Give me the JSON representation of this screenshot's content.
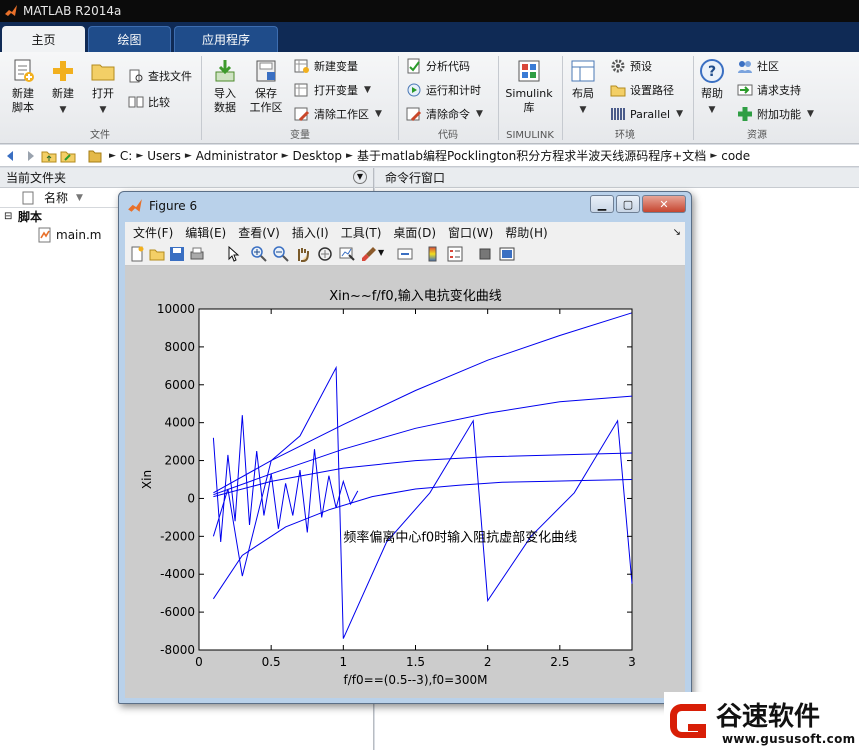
{
  "window": {
    "title": "MATLAB R2014a",
    "accent": "#0f2a55"
  },
  "tabs": [
    {
      "label": "主页",
      "active": true
    },
    {
      "label": "绘图",
      "active": false
    },
    {
      "label": "应用程序",
      "active": false
    }
  ],
  "ribbon": {
    "file": {
      "group_label": "文件",
      "new_script": "新建\n脚本",
      "new": "新建",
      "open": "打开",
      "find_files": "查找文件",
      "compare": "比较"
    },
    "variable": {
      "group_label": "变量",
      "import": "导入\n数据",
      "save_ws": "保存\n工作区",
      "new_var": "新建变量",
      "open_var": "打开变量",
      "clear_ws": "清除工作区"
    },
    "code": {
      "group_label": "代码",
      "analyze": "分析代码",
      "run_time": "运行和计时",
      "clear_cmd": "清除命令"
    },
    "simulink": {
      "group_label": "SIMULINK",
      "label": "Simulink\n库"
    },
    "environment": {
      "group_label": "环境",
      "layout": "布局",
      "prefs": "预设",
      "set_path": "设置路径",
      "parallel": "Parallel"
    },
    "resources": {
      "group_label": "资源",
      "help": "帮助",
      "community": "社区",
      "support": "请求支持",
      "addons": "附加功能"
    }
  },
  "address_bar": {
    "crumbs": [
      "C:",
      "Users",
      "Administrator",
      "Desktop",
      "基于matlab编程Pocklington积分方程求半波天线源码程序+文档",
      "code"
    ]
  },
  "left_panel": {
    "title": "当前文件夹",
    "column": "名称",
    "group": "脚本",
    "files": [
      "main.m"
    ]
  },
  "right_panel": {
    "title": "命令行窗口"
  },
  "figure": {
    "title": "Figure 6",
    "menu": [
      "文件(F)",
      "编辑(E)",
      "查看(V)",
      "插入(I)",
      "工具(T)",
      "桌面(D)",
      "窗口(W)",
      "帮助(H)"
    ],
    "tools": [
      "new-icon",
      "open-icon",
      "save-icon",
      "print-icon",
      "pointer-icon",
      "zoom-in-icon",
      "zoom-out-icon",
      "pan-icon",
      "rotate-icon",
      "data-cursor-icon",
      "brush-icon",
      "link-icon",
      "colorbar-icon",
      "legend-icon",
      "hide-plot-tools-icon",
      "show-plot-tools-icon"
    ]
  },
  "chart_data": {
    "type": "line",
    "title": "Xin~~f/f0,输入电抗变化曲线",
    "xlabel": "f/f0==(0.5--3),f0=300M",
    "ylabel": "Xin",
    "xlim": [
      0,
      3
    ],
    "ylim": [
      -8000,
      10000
    ],
    "xticks": [
      0,
      0.5,
      1,
      1.5,
      2,
      2.5,
      3
    ],
    "yticks": [
      -8000,
      -6000,
      -4000,
      -2000,
      0,
      2000,
      4000,
      6000,
      8000,
      10000
    ],
    "grid": false,
    "annotation": {
      "text": "频率偏离中心f0时输入阻抗虚部变化曲线",
      "x": 1.0,
      "y": -2000
    },
    "line_color": "#0000ee",
    "series": [
      {
        "x": [
          0.1,
          0.5,
          1,
          1.5,
          2,
          2.5,
          3
        ],
        "y": [
          300,
          2000,
          3900,
          5700,
          7300,
          8600,
          9800
        ]
      },
      {
        "x": [
          0.1,
          0.5,
          1,
          1.5,
          2,
          2.5,
          3
        ],
        "y": [
          200,
          1300,
          2600,
          3700,
          4500,
          5100,
          5400
        ]
      },
      {
        "x": [
          0.1,
          0.5,
          1,
          1.5,
          2,
          2.5,
          3
        ],
        "y": [
          100,
          900,
          1600,
          2000,
          2200,
          2300,
          2400
        ]
      },
      {
        "x": [
          0.1,
          0.3,
          0.6,
          0.9,
          1.2,
          1.5,
          1.8,
          2.1,
          2.4,
          2.7,
          3
        ],
        "y": [
          -5300,
          -3000,
          -1500,
          -600,
          100,
          500,
          700,
          850,
          900,
          950,
          1000
        ]
      },
      {
        "x": [
          0.1,
          0.2,
          0.3,
          0.5,
          0.7,
          0.95,
          1.0,
          1.3,
          1.6,
          1.9,
          2.0,
          2.3,
          2.6,
          2.9,
          3.0
        ],
        "y": [
          -2000,
          500,
          -4100,
          2000,
          3300,
          6900,
          -7400,
          -2300,
          300,
          4100,
          -5400,
          -2000,
          300,
          4100,
          -4500
        ]
      },
      {
        "x": [
          0.1,
          0.15,
          0.2,
          0.25,
          0.3,
          0.35,
          0.4,
          0.45,
          0.5,
          0.55,
          0.6,
          0.65,
          0.7,
          0.75,
          0.8,
          0.85,
          0.9,
          0.95,
          1.0,
          1.05,
          1.1
        ],
        "y": [
          3200,
          -2300,
          2300,
          -1200,
          4400,
          -1400,
          2500,
          -900,
          1300,
          -1600,
          800,
          -900,
          1500,
          -1800,
          2600,
          -1000,
          1200,
          -500,
          900,
          -300,
          400
        ]
      }
    ]
  },
  "watermark": {
    "text": "谷速软件",
    "url": "www.gususoft.com",
    "color": "#d81e06"
  }
}
